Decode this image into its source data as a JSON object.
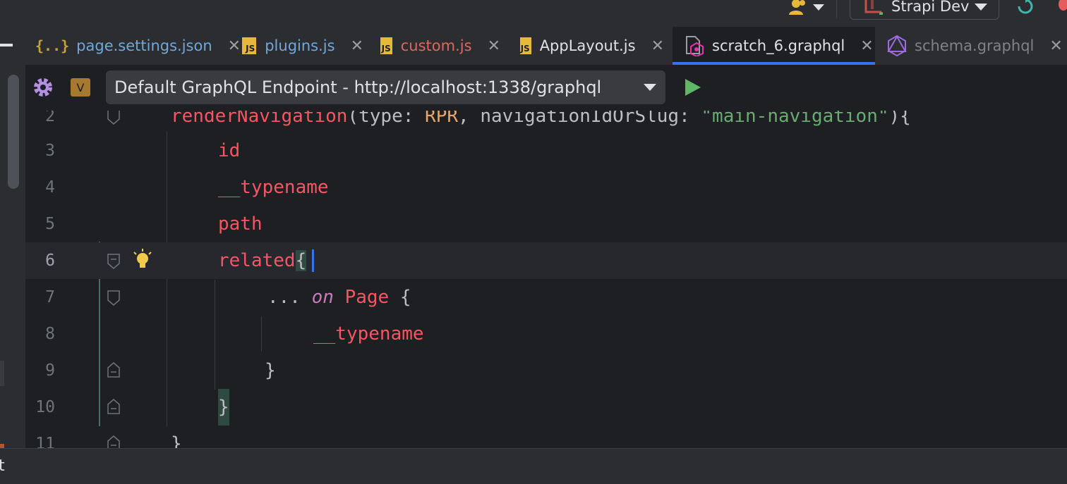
{
  "toolbar": {
    "run_config": "Strapi Dev"
  },
  "tabs": [
    {
      "label": "page.settings.json",
      "icon": "json-icon",
      "color": "#6fa8dc"
    },
    {
      "label": "plugins.js",
      "icon": "js-icon",
      "color": "#6fa8dc"
    },
    {
      "label": "custom.js",
      "icon": "js-icon",
      "color": "#e0675d"
    },
    {
      "label": "AppLayout.js",
      "icon": "js-icon",
      "color": "#dfe1e5"
    },
    {
      "label": "scratch_6.graphql",
      "icon": "graphql-scratch-icon",
      "color": "#dfe1e5",
      "active": true
    },
    {
      "label": "schema.graphql",
      "icon": "graphql-icon",
      "color": "#7f8287"
    }
  ],
  "endpoint": {
    "badge": "V",
    "selected": "Default GraphQL Endpoint - http://localhost:1338/graphql"
  },
  "editor": {
    "line_numbers": [
      "2",
      "3",
      "4",
      "5",
      "6",
      "7",
      "8",
      "9",
      "10",
      "11"
    ],
    "line2": {
      "name": "renderNavigation",
      "open": "(",
      "arg1": "type",
      "colon": ":",
      "val1": "RPR",
      "comma": ",",
      "arg2": "navigationIdOrSlug",
      "val2": "\"main-navigation\"",
      "close": "){"
    },
    "line3": "id",
    "line4": "__typename",
    "line5": "path",
    "line6_field": "related",
    "line6_brace": "{",
    "line7_spread": "...",
    "line7_kw": "on",
    "line7_type": "Page",
    "line7_brace": "{",
    "line8": "__typename",
    "line9": "}",
    "line10": "}",
    "line11": "}"
  },
  "status": {
    "text": "t"
  }
}
